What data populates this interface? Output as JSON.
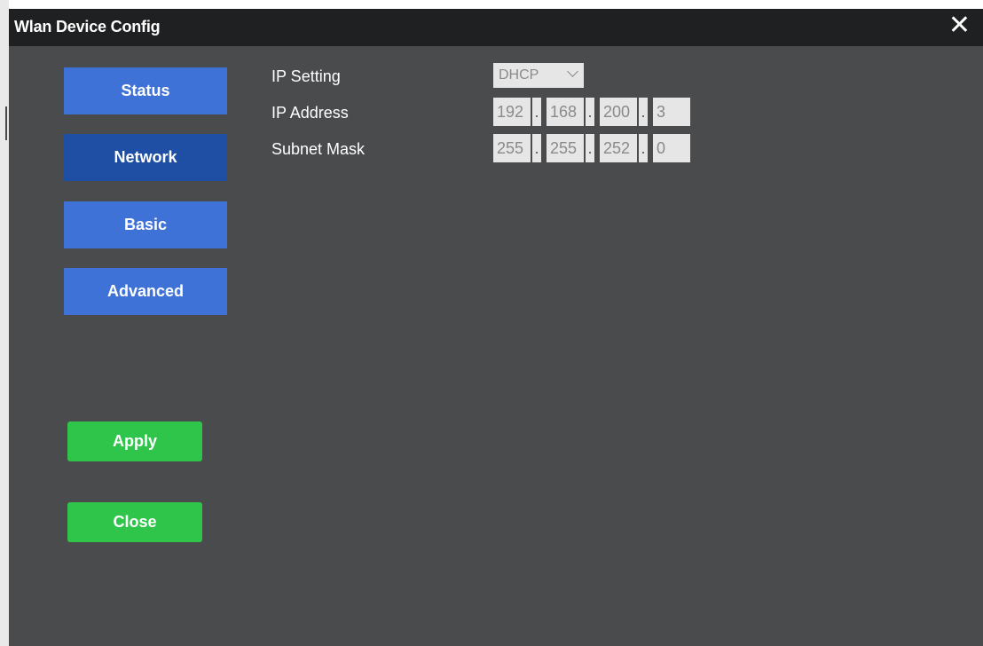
{
  "window": {
    "title": "Wlan Device Config",
    "close_glyph": "✕"
  },
  "nav": {
    "items": [
      {
        "label": "Status"
      },
      {
        "label": "Network"
      },
      {
        "label": "Basic"
      },
      {
        "label": "Advanced"
      }
    ],
    "active": "Network"
  },
  "actions": {
    "apply_label": "Apply",
    "close_label": "Close"
  },
  "form": {
    "ip_setting_label": "IP Setting",
    "ip_setting_value": "DHCP",
    "ip_address_label": "IP Address",
    "ip_address": [
      "192",
      "168",
      "200",
      "3"
    ],
    "subnet_mask_label": "Subnet Mask",
    "subnet_mask": [
      "255",
      "255",
      "252",
      "0"
    ],
    "separator": "."
  },
  "colors": {
    "title_bar": "#1f2021",
    "panel": "#4a4b4d",
    "nav_button": "#3f72d6",
    "nav_button_active": "#1f4fa5",
    "action_button": "#2fc54a",
    "field_bg": "#e6e6e6"
  }
}
